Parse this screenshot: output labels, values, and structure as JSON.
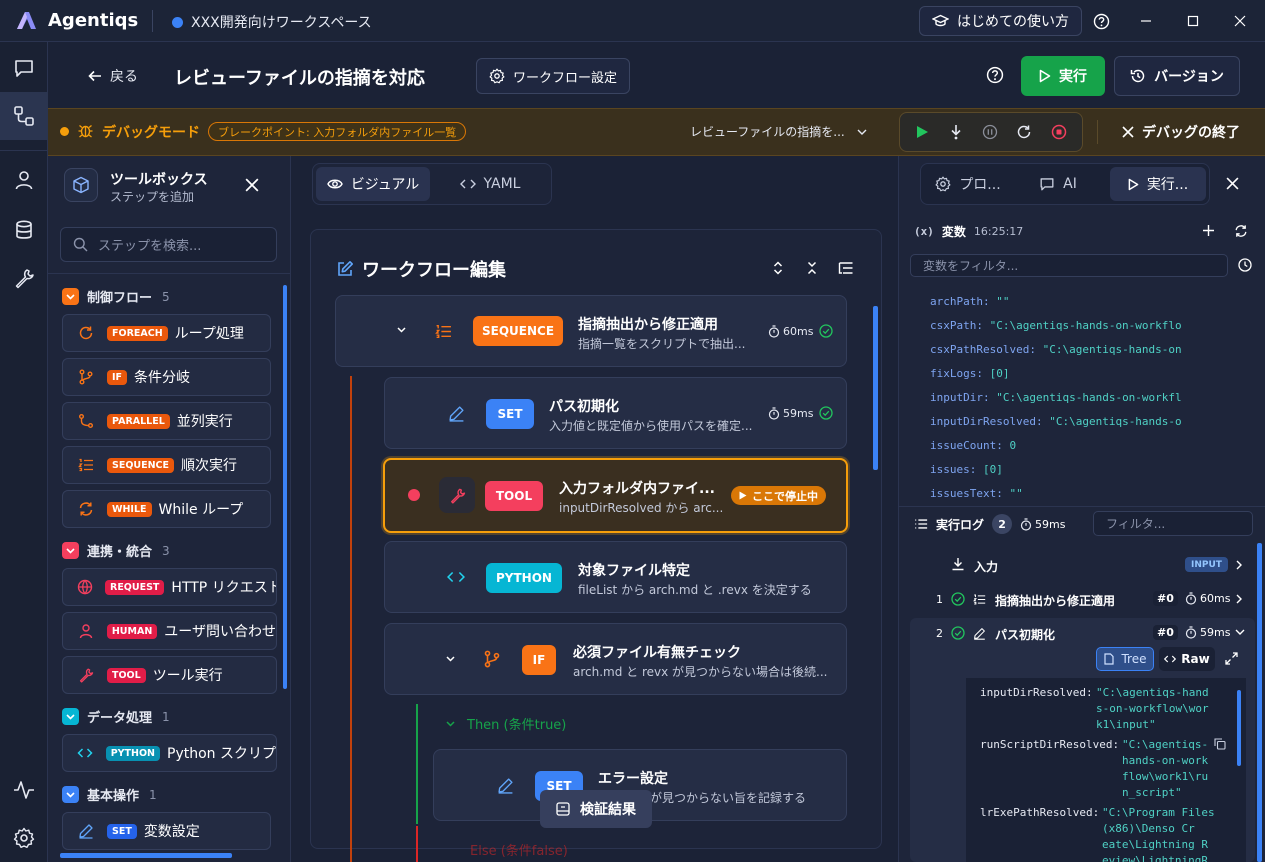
{
  "app": {
    "name": "Agentiqs",
    "workspace": "XXX開発向けワークスペース",
    "guide_label": "はじめての使い方"
  },
  "header": {
    "back_label": "戻る",
    "workflow_title": "レビューファイルの指摘を対応",
    "settings_label": "ワークフロー設定",
    "run_label": "実行",
    "version_label": "バージョン"
  },
  "debug": {
    "mode_label": "デバッグモード",
    "breakpoint_badge": "ブレークポイント: 入力フォルダ内ファイル一覧",
    "selected_workflow": "レビューファイルの指摘を...",
    "end_label": "デバッグの終了"
  },
  "toolbox": {
    "title": "ツールボックス",
    "subtitle": "ステップを追加",
    "search_placeholder": "ステップを検索...",
    "categories": [
      {
        "label": "制御フロー",
        "count": "5",
        "color": "#f97316"
      },
      {
        "label": "連携・統合",
        "count": "3",
        "color": "#f43f5e"
      },
      {
        "label": "データ処理",
        "count": "1",
        "color": "#06b6d4"
      },
      {
        "label": "基本操作",
        "count": "1",
        "color": "#3b82f6"
      }
    ],
    "items": [
      {
        "tag": "FOREACH",
        "label": "ループ処理",
        "icon": "loop-icon"
      },
      {
        "tag": "IF",
        "label": "条件分岐",
        "icon": "branch-icon"
      },
      {
        "tag": "PARALLEL",
        "label": "並列実行",
        "icon": "parallel-icon"
      },
      {
        "tag": "SEQUENCE",
        "label": "順次実行",
        "icon": "list-ordered-icon"
      },
      {
        "tag": "WHILE",
        "label": "While ループ",
        "icon": "repeat-icon"
      },
      {
        "tag": "REQUEST",
        "label": "HTTP リクエスト",
        "icon": "globe-icon"
      },
      {
        "tag": "HUMAN",
        "label": "ユーザ問い合わせ",
        "icon": "user-icon"
      },
      {
        "tag": "TOOL",
        "label": "ツール実行",
        "icon": "wrench-icon"
      },
      {
        "tag": "PYTHON",
        "label": "Python スクリプ",
        "icon": "code-icon"
      },
      {
        "tag": "SET",
        "label": "変数設定",
        "icon": "pencil-icon"
      }
    ]
  },
  "canvas": {
    "tabs": {
      "visual": "ビジュアル",
      "yaml": "YAML"
    },
    "editor_title": "ワークフロー編集",
    "nodes": [
      {
        "tag": "SEQUENCE",
        "title": "指摘抽出から修正適用",
        "desc": "指摘一覧をスクリプトで抽出...",
        "time": "60ms"
      },
      {
        "tag": "SET",
        "title": "パス初期化",
        "desc": "入力値と既定値から使用パスを確定...",
        "time": "59ms"
      },
      {
        "tag": "TOOL",
        "title": "入力フォルダ内ファイ...",
        "desc": "inputDirResolved から arc...",
        "status": "ここで停止中"
      },
      {
        "tag": "PYTHON",
        "title": "対象ファイル特定",
        "desc": "fileList から arch.md と .revx を決定する"
      },
      {
        "tag": "IF",
        "title": "必須ファイル有無チェック",
        "desc": "arch.md と revx が見つからない場合は後続..."
      },
      {
        "tag": "SET",
        "title": "エラー設定",
        "desc": "が見つからない旨を記録する"
      }
    ],
    "then_label": "Then (条件true)",
    "else_label": "Else (条件false)",
    "float_button": "検証結果"
  },
  "right": {
    "tabs": [
      "プロ...",
      "AI",
      "実行..."
    ],
    "vars_title": "変数",
    "vars_time": "16:25:17",
    "var_filter_placeholder": "変数をフィルタ...",
    "variables": [
      {
        "key": "archPath:",
        "value": "\"\""
      },
      {
        "key": "csxPath:",
        "value": "\"C:\\agentiqs-hands-on-workflo"
      },
      {
        "key": "csxPathResolved:",
        "value": "\"C:\\agentiqs-hands-on"
      },
      {
        "key": "fixLogs:",
        "value": "[0]"
      },
      {
        "key": "inputDir:",
        "value": "\"C:\\agentiqs-hands-on-workfl"
      },
      {
        "key": "inputDirResolved:",
        "value": "\"C:\\agentiqs-hands-o"
      },
      {
        "key": "issueCount:",
        "value": "0"
      },
      {
        "key": "issues:",
        "value": "[0]"
      },
      {
        "key": "issuesText:",
        "value": "\"\""
      }
    ],
    "log_title": "実行ログ",
    "log_count": "2",
    "log_time": "59ms",
    "log_filter_placeholder": "フィルタ...",
    "log_rows": [
      {
        "num": "",
        "label": "入力",
        "badge": "INPUT"
      },
      {
        "num": "1",
        "label": "指摘抽出から修正適用",
        "hash": "#0",
        "time": "60ms"
      },
      {
        "num": "2",
        "label": "パス初期化",
        "hash": "#0",
        "time": "59ms"
      }
    ],
    "tree_label": "Tree",
    "raw_label": "Raw",
    "json_lines": [
      {
        "k": "inputDirResolved:",
        "v": [
          "\"C:\\agentiqs-hand",
          "s-on-workflow\\wor",
          "k1\\input\""
        ]
      },
      {
        "k": "runScriptDirResolved:",
        "v": [
          "\"C:\\agentiqs-",
          "hands-on-work",
          "flow\\work1\\ru",
          "n_script\""
        ]
      },
      {
        "k": "lrExePathResolved:",
        "v": [
          "\"C:\\Program Files",
          "(x86)\\Denso Cr",
          "eate\\Lightning R",
          "eview\\LightningR"
        ]
      }
    ]
  }
}
